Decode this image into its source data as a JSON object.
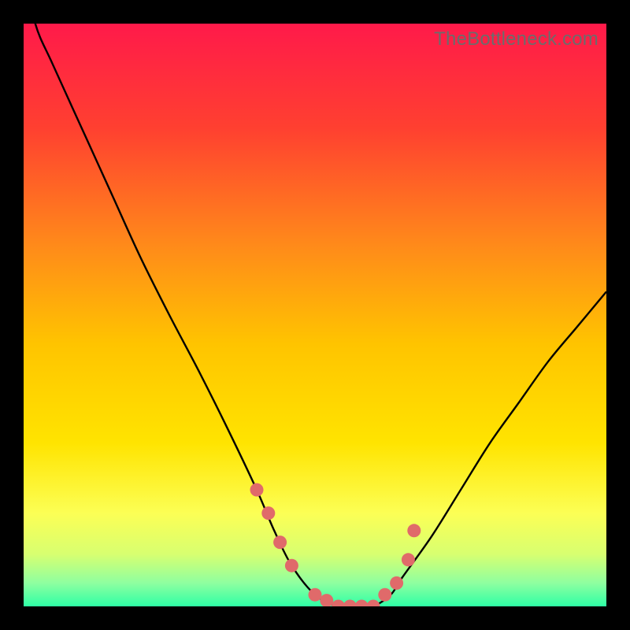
{
  "watermark": "TheBottleneck.com",
  "colors": {
    "black": "#000000",
    "grad_top": "#ff1a4a",
    "grad_mid1": "#ff6a2a",
    "grad_mid2": "#ffb000",
    "grad_mid3": "#ffe400",
    "grad_low1": "#fbff5a",
    "grad_low2": "#c8ff7a",
    "grad_low3": "#7dffab",
    "grad_bot": "#2effa5",
    "curve": "#000000",
    "marker": "#e06a6a"
  },
  "chart_data": {
    "type": "line",
    "title": "",
    "xlabel": "",
    "ylabel": "",
    "xlim": [
      0,
      100
    ],
    "ylim": [
      0,
      100
    ],
    "series": [
      {
        "name": "bottleneck-curve",
        "x": [
          0,
          2,
          5,
          10,
          15,
          20,
          25,
          30,
          35,
          40,
          43,
          46,
          50,
          54,
          58,
          60,
          63,
          65,
          70,
          75,
          80,
          85,
          90,
          95,
          100
        ],
        "y": [
          110,
          100,
          93,
          82,
          71,
          60,
          50,
          40.5,
          30.5,
          20,
          13,
          7,
          2,
          0,
          0,
          0,
          2,
          5,
          12,
          20,
          28,
          35,
          42,
          48,
          54
        ]
      }
    ],
    "markers": {
      "name": "highlighted-points",
      "x": [
        40,
        42,
        44,
        46,
        50,
        52,
        54,
        56,
        58,
        60,
        62,
        64,
        66,
        67
      ],
      "y": [
        20,
        16,
        11,
        7,
        2,
        1,
        0,
        0,
        0,
        0,
        2,
        4,
        8,
        13
      ]
    }
  }
}
